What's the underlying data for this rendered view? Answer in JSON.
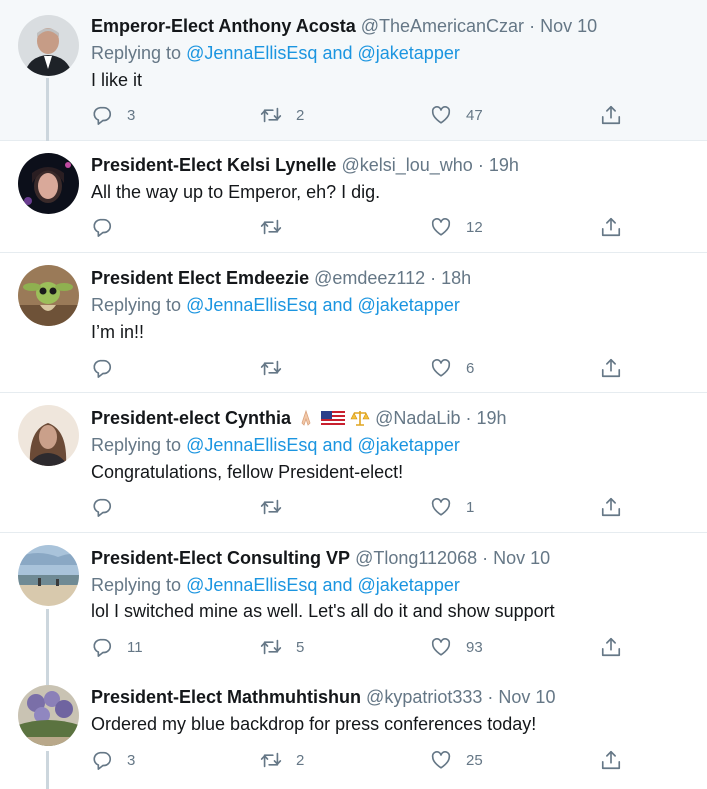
{
  "reply_prefix": "Replying to",
  "reply_and": "and",
  "tweets": [
    {
      "name": "Emperor-Elect Anthony Acosta",
      "handle": "@TheAmericanCzar",
      "time": "Nov 10",
      "reply_to_1": "@JennaEllisEsq",
      "reply_to_2": "@jaketapper",
      "text": "I like it",
      "replies": "3",
      "retweets": "2",
      "likes": "47"
    },
    {
      "name": "President-Elect Kelsi Lynelle",
      "handle": "@kelsi_lou_who",
      "time": "19h",
      "text": "All the way up to Emperor, eh? I dig.",
      "replies": "",
      "retweets": "",
      "likes": "12"
    },
    {
      "name": "President Elect Emdeezie",
      "handle": "@emdeez112",
      "time": "18h",
      "reply_to_1": "@JennaEllisEsq",
      "reply_to_2": "@jaketapper",
      "text": "I’m in!!",
      "replies": "",
      "retweets": "",
      "likes": "6"
    },
    {
      "name": "President-elect Cynthia",
      "handle": "@NadaLib",
      "time": "19h",
      "reply_to_1": "@JennaEllisEsq",
      "reply_to_2": "@jaketapper",
      "text": "Congratulations, fellow President-elect!",
      "replies": "",
      "retweets": "",
      "likes": "1"
    },
    {
      "name": "President-Elect Consulting VP",
      "handle": "@Tlong112068",
      "time": "Nov 10",
      "reply_to_1": "@JennaEllisEsq",
      "reply_to_2": "@jaketapper",
      "text": "lol I switched mine as well. Let's all do it and show support",
      "replies": "11",
      "retweets": "5",
      "likes": "93"
    },
    {
      "name": "President-Elect Mathmuhtishun",
      "handle": "@kypatriot333",
      "time": "Nov 10",
      "text": "Ordered my blue backdrop for press conferences today!",
      "replies": "3",
      "retweets": "2",
      "likes": "25"
    }
  ],
  "colors": {
    "link": "#1b95e0",
    "muted": "#657786",
    "shaded_bg": "#f5f8fa",
    "thread_line": "#ccd6dd"
  },
  "icons": [
    "reply-icon",
    "retweet-icon",
    "like-icon",
    "share-icon"
  ]
}
